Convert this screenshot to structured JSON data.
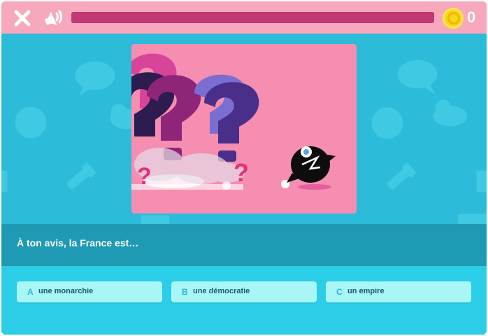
{
  "topbar": {
    "close_icon": "close-icon",
    "sound_icon": "sound-icon",
    "progress": 0.0,
    "coins": "0",
    "coin_icon": "coin-icon"
  },
  "question": {
    "text": "À ton avis, la France est…"
  },
  "answers": [
    {
      "letter": "A",
      "label": "une monarchie"
    },
    {
      "letter": "B",
      "label": "une démocratie"
    },
    {
      "letter": "C",
      "label": "un empire"
    }
  ],
  "colors": {
    "topbar": "#f7a8bd",
    "progress_track": "#c13874",
    "background": "#2cbbd8",
    "question_band": "#1f9ab4",
    "answers_band": "#2ccde6",
    "answer_button": "#a9f6f6",
    "answer_letter": "#2ab5d3",
    "picture_bg": "#f58eb0"
  }
}
